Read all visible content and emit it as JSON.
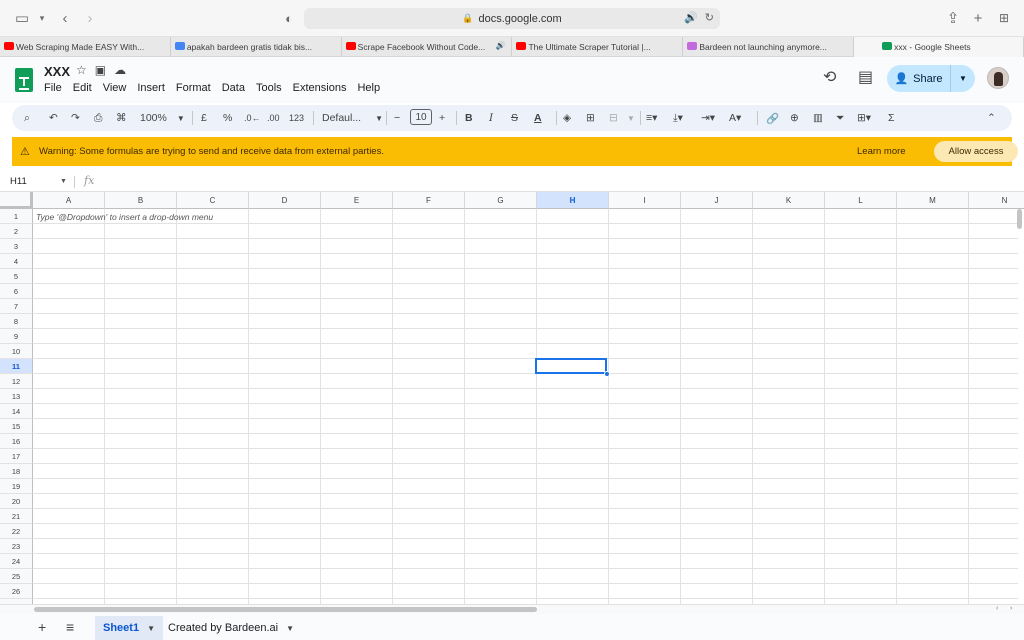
{
  "browser": {
    "url": "docs.google.com",
    "tabs": [
      {
        "label": "Web Scraping Made EASY With...",
        "favicon_color": "#ff0000",
        "width": 171
      },
      {
        "label": "apakah bardeen gratis tidak bis...",
        "favicon_color": "#4285f4",
        "width": 171
      },
      {
        "label": "Scrape Facebook Without Code...",
        "favicon_color": "#ff0000",
        "width": 171,
        "audio": true
      },
      {
        "label": "The Ultimate Scraper Tutorial |...",
        "favicon_color": "#ff0000",
        "width": 171
      },
      {
        "label": "Bardeen not launching anymore...",
        "favicon_color": "#c36adf",
        "width": 171
      },
      {
        "label": "xxx - Google Sheets",
        "favicon_color": "#0f9d58",
        "width": 170,
        "active": true
      }
    ]
  },
  "doc": {
    "title": "XXX",
    "menu": [
      "File",
      "Edit",
      "View",
      "Insert",
      "Format",
      "Data",
      "Tools",
      "Extensions",
      "Help"
    ],
    "share_label": "Share"
  },
  "toolbar": {
    "zoom": "100%",
    "currency": "£",
    "percent": "%",
    "dec_less": ".0←",
    "dec_more": ".00",
    "number_format": "123",
    "font": "Defaul...",
    "font_size": "10"
  },
  "warning": {
    "text": "Warning: Some formulas are trying to send and receive data from external parties.",
    "learn_more": "Learn more",
    "allow_access": "Allow access"
  },
  "formula": {
    "cell_ref": "H11",
    "fx": "fx"
  },
  "sheet": {
    "columns": [
      "A",
      "B",
      "C",
      "D",
      "E",
      "F",
      "G",
      "H",
      "I",
      "J",
      "K",
      "L",
      "M",
      "N"
    ],
    "rows": [
      "1",
      "2",
      "3",
      "4",
      "5",
      "6",
      "7",
      "8",
      "9",
      "10",
      "11",
      "12",
      "13",
      "14",
      "15",
      "16",
      "17",
      "18",
      "19",
      "20",
      "21",
      "22",
      "23",
      "24",
      "25",
      "26",
      "27"
    ],
    "selected_column": "H",
    "selected_row": "11",
    "hint_text": "Type '@Dropdown' to insert a drop-down menu"
  },
  "bottom": {
    "sheet_tabs": [
      "Sheet1",
      "Created by Bardeen.ai"
    ]
  }
}
